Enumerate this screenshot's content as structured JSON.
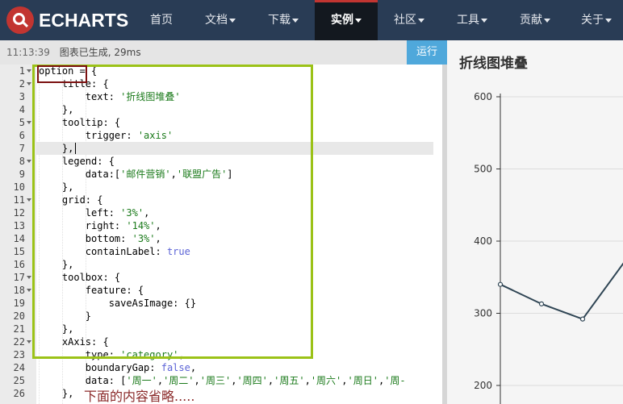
{
  "nav": {
    "logo_text": "ECHARTS",
    "items": [
      {
        "label": "首页",
        "dropdown": false,
        "active": false
      },
      {
        "label": "文档",
        "dropdown": true,
        "active": false
      },
      {
        "label": "下载",
        "dropdown": true,
        "active": false
      },
      {
        "label": "实例",
        "dropdown": true,
        "active": true
      },
      {
        "label": "社区",
        "dropdown": true,
        "active": false
      },
      {
        "label": "工具",
        "dropdown": true,
        "active": false
      },
      {
        "label": "贡献",
        "dropdown": true,
        "active": false
      },
      {
        "label": "关于",
        "dropdown": true,
        "active": false
      }
    ]
  },
  "status": {
    "time": "11:13:39",
    "message": "图表已生成, 29ms"
  },
  "run_label": "运行",
  "editor": {
    "lines": [
      "option = {",
      "    title: {",
      "        text: '折线图堆叠'",
      "    },",
      "    tooltip: {",
      "        trigger: 'axis'",
      "    },",
      "    legend: {",
      "        data:['邮件营销','联盟广告']",
      "    },",
      "    grid: {",
      "        left: '3%',",
      "        right: '14%',",
      "        bottom: '3%',",
      "        containLabel: true",
      "    },",
      "    toolbox: {",
      "        feature: {",
      "            saveAsImage: {}",
      "        }",
      "    },",
      "    xAxis: {",
      "        type: 'category',",
      "        boundaryGap: false,",
      "        data: ['周一','周二','周三','周四','周五','周六','周日','周-",
      "    },"
    ],
    "fold_lines": [
      1,
      2,
      5,
      8,
      11,
      17,
      18,
      22
    ]
  },
  "annotation_note": "下面的内容省略.....",
  "chart": {
    "title": "折线图堆叠"
  },
  "chart_data": {
    "type": "line",
    "title": "折线图堆叠",
    "y_ticks": [
      200,
      300,
      400,
      500,
      600
    ],
    "ylim": [
      200,
      600
    ],
    "series": [
      {
        "values": [
          340,
          313,
          292,
          370
        ]
      }
    ],
    "line_color": "#2f4554",
    "grid": true
  }
}
